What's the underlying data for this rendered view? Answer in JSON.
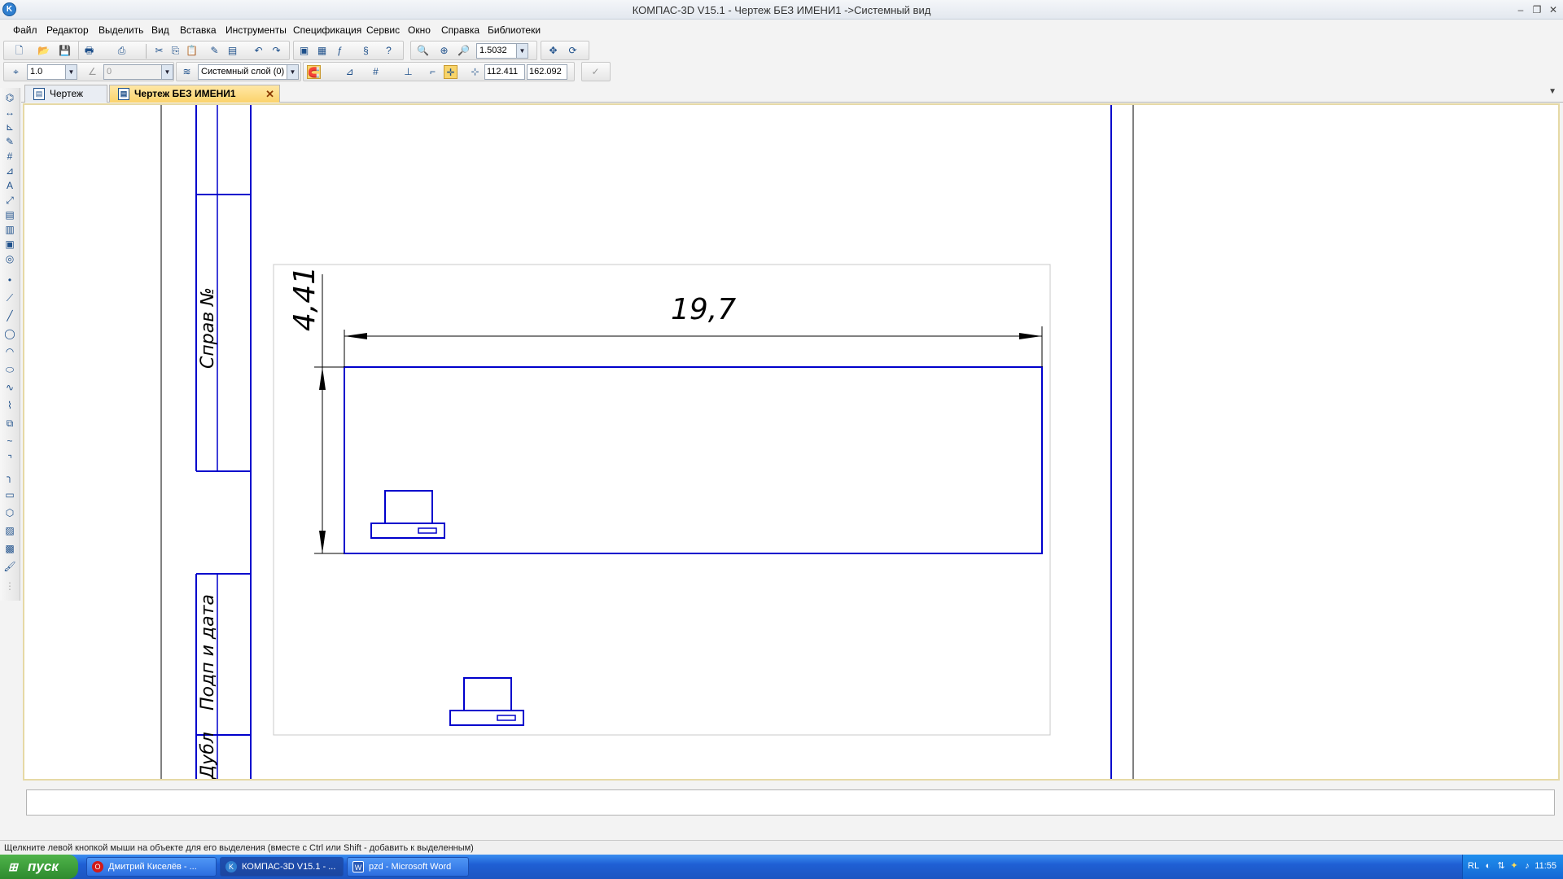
{
  "window": {
    "title": "КОМПАС-3D V15.1 - Чертеж БЕЗ ИМЕНИ1 ->Системный вид",
    "app_icon": "kompas-icon",
    "controls": {
      "minimize": "–",
      "restore": "❐",
      "close": "✕"
    }
  },
  "menu": [
    "Файл",
    "Редактор",
    "Выделить",
    "Вид",
    "Вставка",
    "Инструменты",
    "Спецификация",
    "Сервис",
    "Окно",
    "Справка",
    "Библиотеки"
  ],
  "toolbar_standard": {
    "zoom_value": "1.5032"
  },
  "toolbar_current_state": {
    "step_value": "1.0",
    "angle_value": "0",
    "layer_value": "Системный слой (0)",
    "coord_x": "112.411",
    "coord_y": "162.092"
  },
  "tabs": [
    {
      "label": "Чертеж",
      "active": false
    },
    {
      "label": "Чертеж БЕЗ ИМЕНИ1",
      "active": true,
      "close": "✕"
    }
  ],
  "drawing": {
    "stamp_labels": [
      "Справ №",
      "Подп и дата",
      "Дубл"
    ],
    "dimension_horizontal": "19,7",
    "dimension_vertical": "4,41",
    "line_color": "#0000cc"
  },
  "status_bar": {
    "hint": "Щелкните левой кнопкой мыши на объекте для его выделения (вместе с Ctrl или Shift - добавить к выделенным)"
  },
  "taskbar": {
    "start_label": "пуск",
    "tasks": [
      {
        "label": "Дмитрий Киселёв - ...",
        "icon": "opera-icon",
        "active": false
      },
      {
        "label": "КОМПАС-3D V15.1 - ...",
        "icon": "kompas-icon",
        "active": true
      },
      {
        "label": "pzd - Microsoft Word",
        "icon": "word-icon",
        "active": false
      }
    ],
    "tray_lang": "RL",
    "clock": "11:55"
  }
}
